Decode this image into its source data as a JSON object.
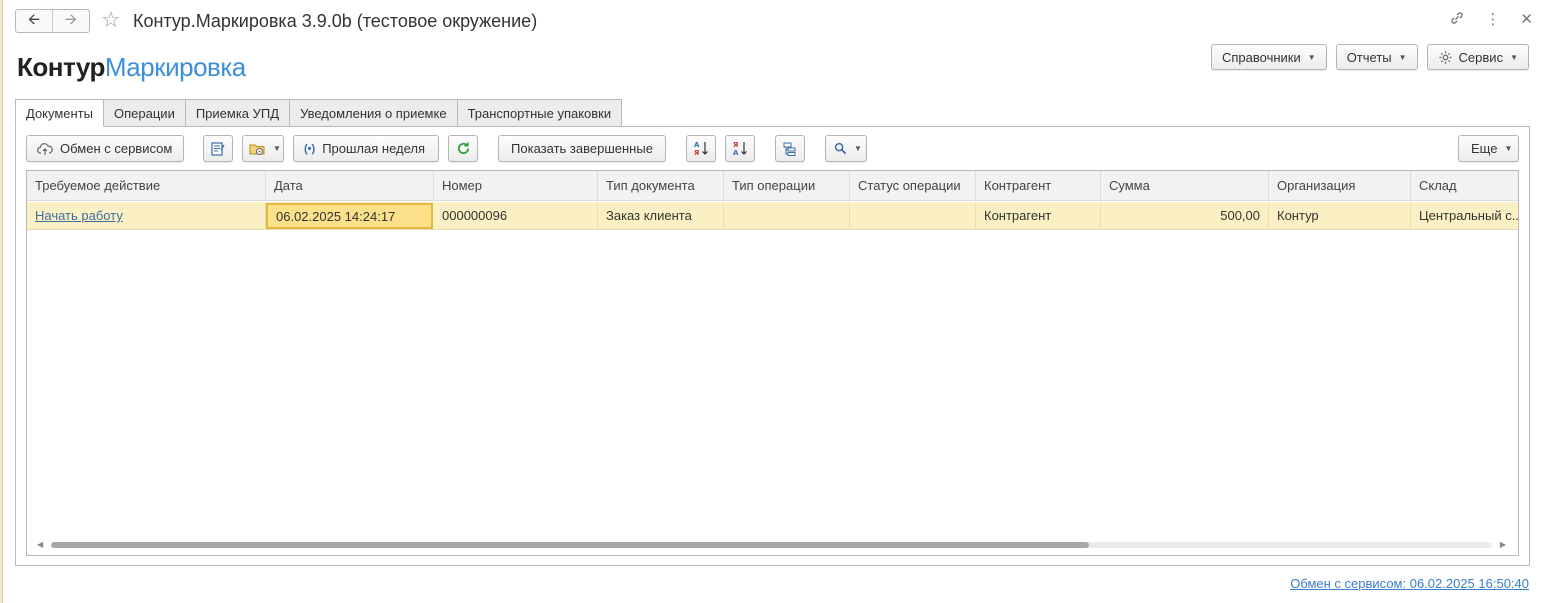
{
  "window": {
    "title": "Контур.Маркировка 3.9.0b (тестовое окружение)"
  },
  "logo": {
    "brand": "Контур",
    "product": "Маркировка"
  },
  "top_menu": {
    "refs": "Справочники",
    "reports": "Отчеты",
    "service": "Сервис"
  },
  "tabs": [
    {
      "label": "Документы",
      "active": true
    },
    {
      "label": "Операции"
    },
    {
      "label": "Приемка УПД"
    },
    {
      "label": "Уведомления о приемке"
    },
    {
      "label": "Транспортные упаковки"
    }
  ],
  "toolbar": {
    "exchange": "Обмен с сервисом",
    "period": "Прошлая неделя",
    "show_completed": "Показать завершенные",
    "more": "Еще"
  },
  "table": {
    "columns": [
      "Требуемое действие",
      "Дата",
      "Номер",
      "Тип документа",
      "Тип операции",
      "Статус операции",
      "Контрагент",
      "Сумма",
      "Организация",
      "Склад"
    ],
    "rows": [
      [
        "Начать работу",
        "06.02.2025 14:24:17",
        "000000096",
        "Заказ клиента",
        "",
        "",
        "Контрагент",
        "500,00",
        "Контур",
        "Центральный с..."
      ]
    ]
  },
  "status_link": "Обмен с сервисом: 06.02.2025 16:50:40",
  "colors": {
    "accent": "#3d8fd8",
    "row_highlight": "#fbf0c3",
    "link": "#3a7ec7"
  }
}
